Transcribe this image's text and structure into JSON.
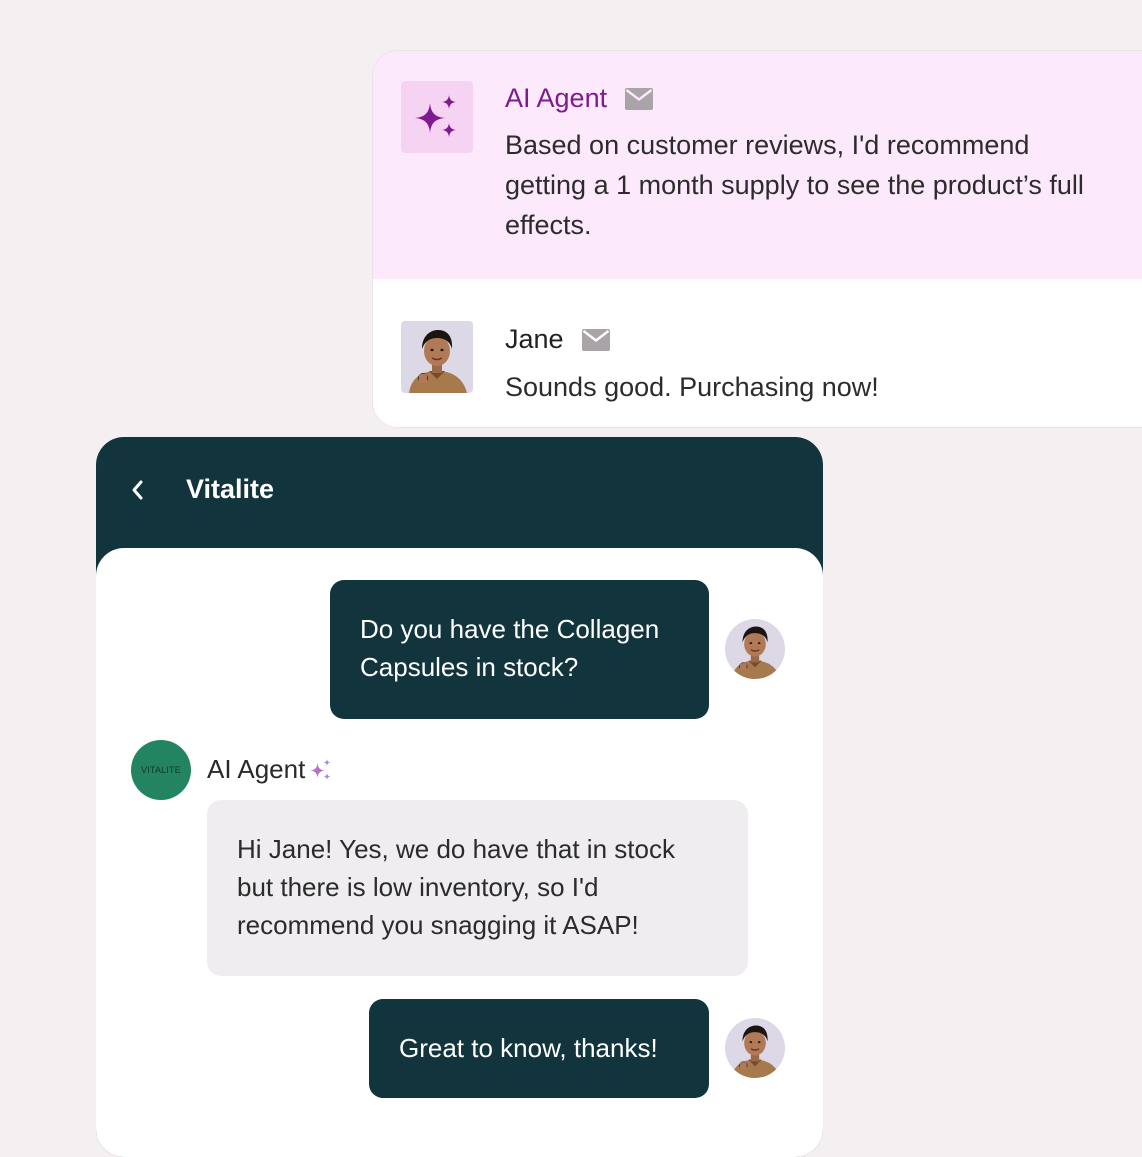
{
  "email_thread": {
    "agent_message": {
      "sender": "AI Agent",
      "channel_icon": "mail-icon",
      "badge_icon": "sparkles-icon",
      "text": "Based on customer reviews, I'd recommend getting a 1 month supply to see the product’s full effects."
    },
    "customer_message": {
      "sender": "Jane",
      "channel_icon": "mail-icon",
      "text": "Sounds good. Purchasing now!"
    }
  },
  "chat": {
    "title": "Vitalite",
    "messages": [
      {
        "from": "customer",
        "text": "Do you have the Collagen Capsules in stock?"
      },
      {
        "from": "agent",
        "sender": "AI Agent",
        "avatar_text": "VITALITE",
        "text": "Hi Jane! Yes, we do have that in stock but there is low inventory, so I'd recommend you snagging it ASAP!"
      },
      {
        "from": "customer",
        "text": "Great to know, thanks!"
      }
    ]
  },
  "colors": {
    "background": "#f4f0f1",
    "chat_header": "#12343d",
    "agent_highlight": "#fce9fb",
    "agent_accent": "#7e1b8f",
    "brand_green": "#238461"
  }
}
